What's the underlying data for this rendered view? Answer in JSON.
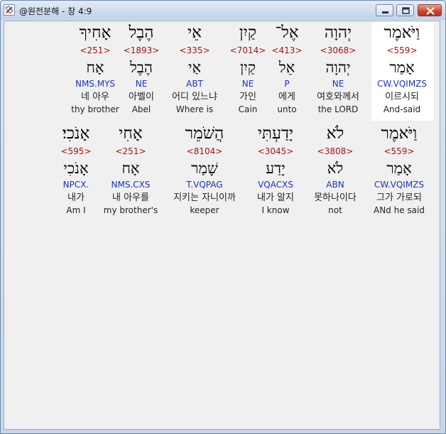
{
  "window": {
    "title": "@원전분해 - 창 4:9"
  },
  "rows": [
    {
      "words": [
        {
          "hebrew": "אָחִיךָ",
          "strong": "<251>",
          "root": "אָח",
          "parse": "NMS.MYS",
          "korean": "네 아우",
          "english": "thy brother"
        },
        {
          "hebrew": "הֶבֶל",
          "strong": "<1893>",
          "root": "הֶבֶל",
          "parse": "NE",
          "korean": "아벨이",
          "english": "Abel"
        },
        {
          "hebrew": "אֵי",
          "strong": "<335>",
          "root": "אַי",
          "parse": "ABT",
          "korean": "어디 있느냐",
          "english": "Where is"
        },
        {
          "hebrew": "קַיִן",
          "strong": "<7014>",
          "root": "קַיִן",
          "parse": "NE",
          "korean": "가인",
          "english": "Cain"
        },
        {
          "hebrew": "אֶל־",
          "strong": "<413>",
          "root": "אֵל",
          "parse": "P",
          "korean": "에게",
          "english": "unto"
        },
        {
          "hebrew": "יְהוָה",
          "strong": "<3068>",
          "root": "יְהוָה",
          "parse": "NE",
          "korean": "여호와께서",
          "english": "the LORD"
        },
        {
          "hebrew": "וַיֹּאמֶר",
          "strong": "<559>",
          "root": "אָמַר",
          "parse": "CW.VQIMZS",
          "korean": "이르시되",
          "english": "And-said"
        }
      ]
    },
    {
      "words": [
        {
          "hebrew": "אָנֹכִי׃",
          "strong": "<595>",
          "root": "אָנֹכִי",
          "parse": "NPCX.",
          "korean": "내가",
          "english": "Am I"
        },
        {
          "hebrew": "אָחִי",
          "strong": "<251>",
          "root": "אָח",
          "parse": "NMS.CXS",
          "korean": "내 아우를",
          "english": "my brother's"
        },
        {
          "hebrew": "הֲשֹׁמֵר",
          "strong": "<8104>",
          "root": "שָׁמַר",
          "parse": "T.VQPAG",
          "korean": "지키는 자니이까",
          "english": "keeper"
        },
        {
          "hebrew": "יָדַעְתִּי",
          "strong": "<3045>",
          "root": "יָדַע",
          "parse": "VQACXS",
          "korean": "내가 알지",
          "english": "I know"
        },
        {
          "hebrew": "לֹא",
          "strong": "<3808>",
          "root": "לֹא",
          "parse": "ABN",
          "korean": "못하나이다",
          "english": "not"
        },
        {
          "hebrew": "וַיֹּאמֶר",
          "strong": "<559>",
          "root": "אָמַר",
          "parse": "CW.VQIMZS",
          "korean": "그가 가로되",
          "english": "ANd he said"
        }
      ]
    }
  ]
}
